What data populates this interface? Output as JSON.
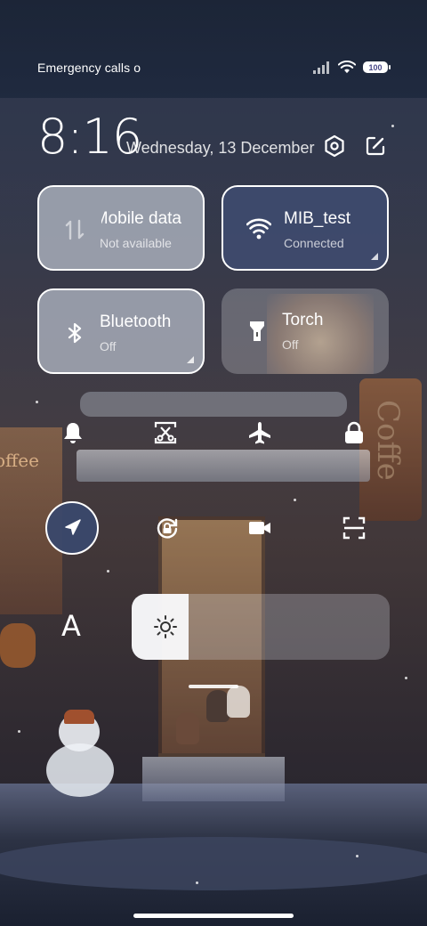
{
  "status_bar": {
    "carrier_text": "Emergency calls o",
    "battery_level": "100",
    "icons": [
      "signal-icon",
      "wifi-icon",
      "battery-icon"
    ]
  },
  "header": {
    "time": "8:16",
    "date": "Wednesday, 13 December",
    "icons": [
      "settings-icon",
      "edit-icon"
    ]
  },
  "tiles": {
    "mobile_data": {
      "name": "Mobile data",
      "status": "Not available",
      "icon": "mobile-data-icon",
      "active": false
    },
    "wifi": {
      "name": "MIB_test",
      "status": "Connected",
      "icon": "wifi-icon",
      "active": true
    },
    "bluetooth": {
      "name": "Bluetooth",
      "status": "Off",
      "icon": "bluetooth-icon",
      "active": false
    },
    "torch": {
      "name": "Torch",
      "status": "Off",
      "icon": "torch-icon",
      "active": false
    }
  },
  "toggles_row1": [
    {
      "name": "notifications-toggle",
      "icon": "bell-icon"
    },
    {
      "name": "screenshot-toggle",
      "icon": "scissors-icon"
    },
    {
      "name": "airplane-toggle",
      "icon": "airplane-icon"
    },
    {
      "name": "lock-toggle",
      "icon": "lock-icon"
    }
  ],
  "toggles_row2": [
    {
      "name": "location-toggle",
      "icon": "location-icon",
      "active": true
    },
    {
      "name": "rotation-lock-toggle",
      "icon": "rotation-lock-icon",
      "active": false
    },
    {
      "name": "screen-record-toggle",
      "icon": "video-icon",
      "active": false
    },
    {
      "name": "scanner-toggle",
      "icon": "scan-icon",
      "active": false
    }
  ],
  "font_size": {
    "label": "A"
  },
  "brightness": {
    "level": 0.22,
    "icon": "sun-icon"
  },
  "colors": {
    "active_tile": "#3e4a6e",
    "inactive_tile": "#b2b8c4",
    "accent_border": "#ffffff"
  }
}
